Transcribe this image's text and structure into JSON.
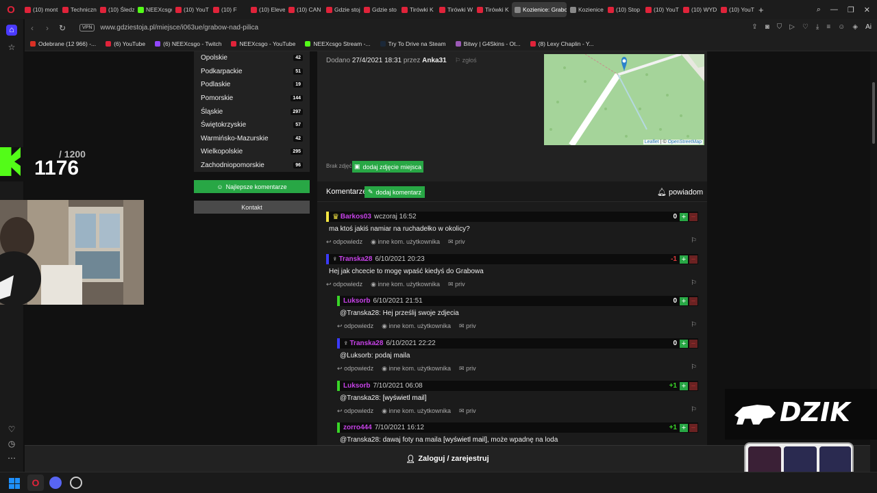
{
  "browser": {
    "logo": "O",
    "tabs": [
      {
        "label": "(10) mont",
        "color": "#e0233a"
      },
      {
        "label": "Techniczn",
        "color": "#e0233a"
      },
      {
        "label": "(10) Śledz",
        "color": "#e0233a"
      },
      {
        "label": "NEEXcsgo",
        "color": "#53fc18"
      },
      {
        "label": "(10) YouT",
        "color": "#e0233a"
      },
      {
        "label": "(10) F",
        "color": "#e0233a"
      },
      {
        "label": "(10) Eleve",
        "color": "#e0233a"
      },
      {
        "label": "(10) CAN",
        "color": "#e0233a"
      },
      {
        "label": "Gdzie stoj",
        "color": "#e0233a"
      },
      {
        "label": "Gdzie sto",
        "color": "#e0233a"
      },
      {
        "label": "Tirówki K",
        "color": "#e0233a"
      },
      {
        "label": "Tirówki W",
        "color": "#e0233a"
      },
      {
        "label": "Tirówki K",
        "color": "#e0233a"
      },
      {
        "label": "Kozienice: Grabo",
        "color": "#888888",
        "active": true
      },
      {
        "label": "Kozienice",
        "color": "#888888"
      },
      {
        "label": "(10) Stop",
        "color": "#e0233a"
      },
      {
        "label": "(10) YouT",
        "color": "#e0233a"
      },
      {
        "label": "(10) WYD",
        "color": "#e0233a"
      },
      {
        "label": "(10) YouT",
        "color": "#e0233a"
      }
    ],
    "new_tab": "+",
    "url": "www.gdziestoja.pl/miejsce/i063ue/grabow-nad-pilica",
    "vpn": "VPN",
    "bookmarks": [
      {
        "label": "Odebrane (12 966) -...",
        "color": "#d93025"
      },
      {
        "label": "(6) YouTube",
        "color": "#e0233a"
      },
      {
        "label": "(6) NEEXcsgo - Twitch",
        "color": "#9146ff"
      },
      {
        "label": "NEEXcsgo - YouTube",
        "color": "#e0233a"
      },
      {
        "label": "NEEXcsgo Stream -...",
        "color": "#53fc18"
      },
      {
        "label": "Try To Drive na Steam",
        "color": "#1b2838"
      },
      {
        "label": "Bitwy | G4Skins - Ot...",
        "color": "#9b59b6"
      },
      {
        "label": "(8) Lexy Chaplin - Y...",
        "color": "#e0233a"
      }
    ]
  },
  "regions": [
    {
      "name": "Opolskie",
      "count": "42"
    },
    {
      "name": "Podkarpackie",
      "count": "51"
    },
    {
      "name": "Podlaskie",
      "count": "19"
    },
    {
      "name": "Pomorskie",
      "count": "144"
    },
    {
      "name": "Śląskie",
      "count": "297"
    },
    {
      "name": "Świętokrzyskie",
      "count": "57"
    },
    {
      "name": "Warmińsko-Mazurskie",
      "count": "42"
    },
    {
      "name": "Wielkopolskie",
      "count": "295"
    },
    {
      "name": "Zachodniopomorskie",
      "count": "96"
    }
  ],
  "left_buttons": {
    "best_comments": "Najlepsze komentarze",
    "contact": "Kontakt"
  },
  "info": {
    "added_prefix": "Dodano",
    "added_date": "27/4/2021 18:31",
    "by": "przez",
    "author": "Anka31",
    "report": "zgłoś",
    "no_photos": "Brak zdjęć",
    "add_photo": "dodaj zdjęcie miejsca",
    "map_attr_leaflet": "Leaflet",
    "map_attr_sep": "| ©",
    "map_attr_osm": "OpenStreetMap"
  },
  "comments_header": {
    "title": "Komentarze",
    "add": "dodaj komentarz",
    "notify": "powiadom"
  },
  "comment_actions": {
    "reply": "odpowiedz",
    "other": "inne kom. użytkownika",
    "priv": "priv"
  },
  "comments": [
    {
      "author": "Barkos03",
      "date": "wczoraj 16:52",
      "text": "ma ktoś jakiś namiar na ruchadełko w okolicy?",
      "score": "0",
      "border": "#f5e642",
      "icon": "crown"
    },
    {
      "author": "Transka28",
      "date": "6/10/2021 20:23",
      "text": "Hej jak chcecie to mogę wpaść kiedyś do Grabowa",
      "score": "-1",
      "border": "#3b3bff",
      "icon": "female"
    },
    {
      "author": "Luksorb",
      "date": "6/10/2021 21:51",
      "text": "@Transka28: Hej prześlij swoje zdjecia",
      "score": "0",
      "border": "#39d628"
    },
    {
      "author": "Transka28",
      "date": "6/10/2021 22:22",
      "text": "@Luksorb: podaj maila",
      "score": "0",
      "border": "#3b3bff",
      "icon": "female"
    },
    {
      "author": "Luksorb",
      "date": "7/10/2021 06:08",
      "text_prefix": "@Transka28: ",
      "text_bold": "[wyświetl mail]",
      "score": "+1",
      "border": "#39d628"
    },
    {
      "author": "zorro444",
      "date": "7/10/2021 16:12",
      "text_prefix": "@Transka28: dawaj foty na maila ",
      "text_bold": "[wyświetl mail]",
      "text_suffix": ", może wpadnę na loda",
      "score": "+1",
      "border": "#39d628"
    }
  ],
  "login": "Zaloguj / zarejestruj",
  "overlay": {
    "goal": "/ 1200",
    "count": "1176",
    "brand": "DZIK"
  }
}
